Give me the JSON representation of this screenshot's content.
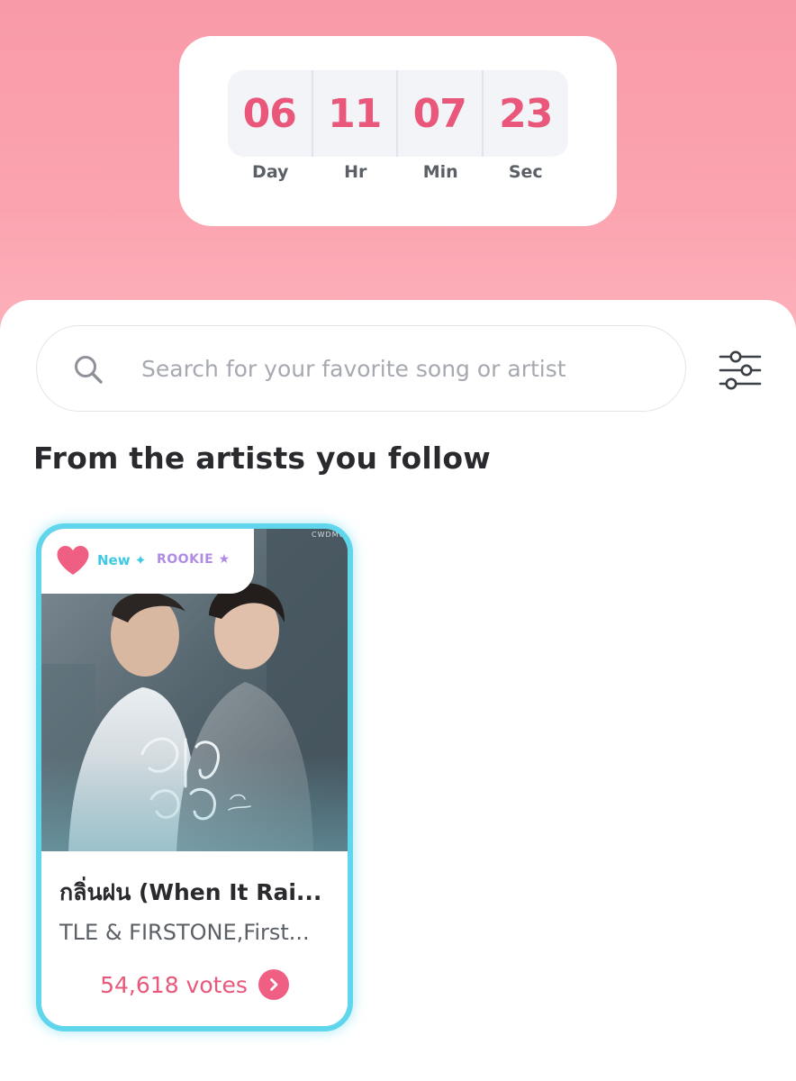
{
  "countdown": {
    "days": "06",
    "hours": "11",
    "minutes": "07",
    "seconds": "23",
    "day_label": "Day",
    "hour_label": "Hr",
    "minute_label": "Min",
    "second_label": "Sec"
  },
  "search": {
    "placeholder": "Search for your favorite song or artist",
    "value": ""
  },
  "section": {
    "title": "From the artists you follow"
  },
  "song_card": {
    "badge_new": "New ✦",
    "badge_rookie": "ROOKIE ★",
    "title": "กลิ่นฝน (When It Rai...",
    "artist": "TLE & FIRSTONE,First...",
    "votes": "54,618 votes",
    "cover_watermark": "CWDMUSIC"
  },
  "colors": {
    "accent_pink": "#e9577a",
    "card_border_cyan": "#5fd6ec",
    "header_gradient_top": "#f99aa8",
    "header_gradient_bottom": "#fcb5bd"
  }
}
